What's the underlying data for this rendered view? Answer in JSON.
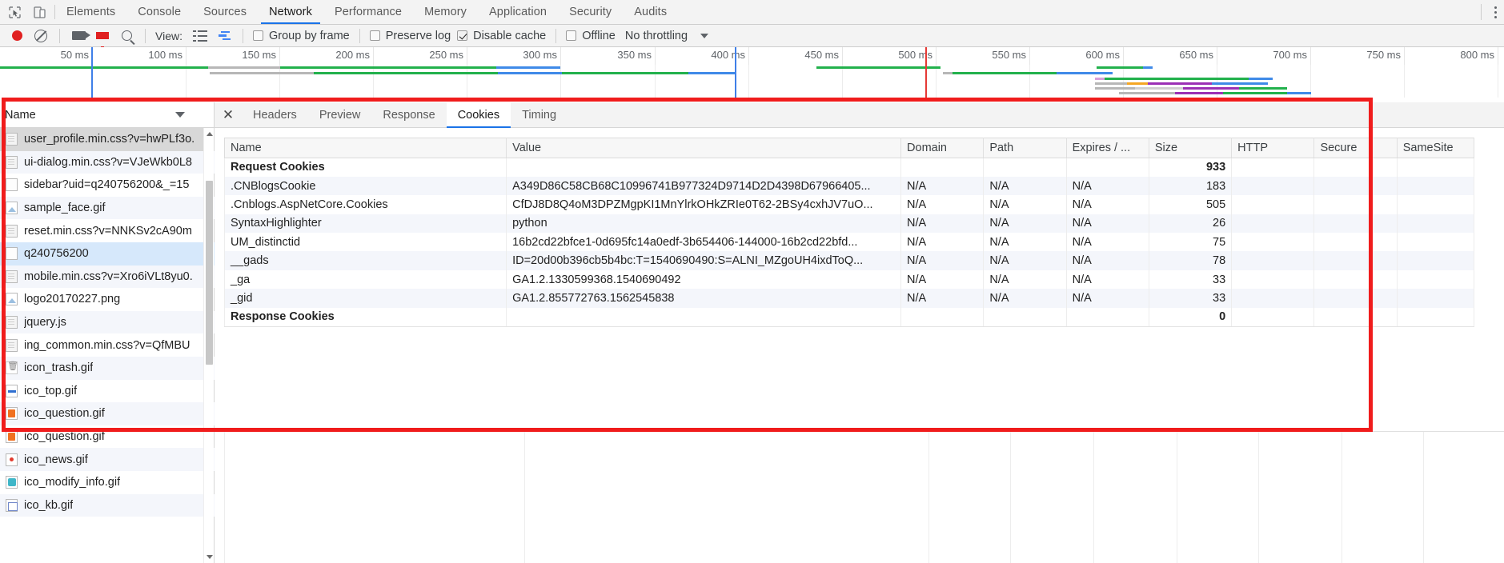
{
  "browser_tabs": {
    "inspect_icon": "inspect-element-icon",
    "device_icon": "device-toolbar-icon",
    "items": [
      {
        "label": "Elements",
        "active": false
      },
      {
        "label": "Console",
        "active": false
      },
      {
        "label": "Sources",
        "active": false
      },
      {
        "label": "Network",
        "active": true
      },
      {
        "label": "Performance",
        "active": false
      },
      {
        "label": "Memory",
        "active": false
      },
      {
        "label": "Application",
        "active": false
      },
      {
        "label": "Security",
        "active": false
      },
      {
        "label": "Audits",
        "active": false
      }
    ],
    "menu_icon": "kebab-menu-icon"
  },
  "network_toolbar": {
    "record_label": "record-button",
    "clear_label": "clear-button",
    "camera_label": "capture-screenshots-button",
    "filter_label": "filter-button",
    "search_label": "search-button",
    "view_label": "View:",
    "list_view": "list-view-icon",
    "waterfall_view": "waterfall-view-icon",
    "group_by_frame": {
      "label": "Group by frame",
      "checked": false,
      "disabled": true
    },
    "preserve_log": {
      "label": "Preserve log",
      "checked": false
    },
    "disable_cache": {
      "label": "Disable cache",
      "checked": true
    },
    "offline": {
      "label": "Offline",
      "checked": false
    },
    "throttling": {
      "label": "No throttling",
      "caret": "chevron-down-icon"
    }
  },
  "overview": {
    "ticks": [
      "50 ms",
      "100 ms",
      "150 ms",
      "200 ms",
      "250 ms",
      "300 ms",
      "350 ms",
      "400 ms",
      "450 ms",
      "500 ms",
      "550 ms",
      "600 ms",
      "650 ms",
      "700 ms",
      "750 ms",
      "800 ms"
    ],
    "dom_content_loaded_color": "#3f7fe8",
    "load_color": "#e53935"
  },
  "left_panel": {
    "column_header": "Name",
    "sort_caret": "chevron-down-icon",
    "files": [
      {
        "name": "user_profile.min.css?v=hwPLf3o.",
        "icon": "stylesheet-icon",
        "state": "hover"
      },
      {
        "name": "ui-dialog.min.css?v=VJeWkb0L8",
        "icon": "stylesheet-icon",
        "state": "odd"
      },
      {
        "name": "sidebar?uid=q240756200&_=15",
        "icon": "document-icon",
        "state": "normal"
      },
      {
        "name": "sample_face.gif",
        "icon": "image-icon",
        "state": "odd"
      },
      {
        "name": "reset.min.css?v=NNKSv2cA90m",
        "icon": "stylesheet-icon",
        "state": "normal"
      },
      {
        "name": "q240756200",
        "icon": "document-icon",
        "state": "selected"
      },
      {
        "name": "mobile.min.css?v=Xro6iVLt8yu0.",
        "icon": "stylesheet-icon",
        "state": "odd"
      },
      {
        "name": "logo20170227.png",
        "icon": "image-icon",
        "state": "normal"
      },
      {
        "name": "jquery.js",
        "icon": "script-icon",
        "state": "odd"
      },
      {
        "name": "ing_common.min.css?v=QfMBU",
        "icon": "stylesheet-icon",
        "state": "normal"
      },
      {
        "name": "icon_trash.gif",
        "icon": "trash-image-icon",
        "state": "odd"
      },
      {
        "name": "ico_top.gif",
        "icon": "blue-image-icon",
        "state": "normal"
      },
      {
        "name": "ico_question.gif",
        "icon": "orange-image-icon",
        "state": "odd"
      },
      {
        "name": "ico_question.gif",
        "icon": "orange-image-icon",
        "state": "normal"
      },
      {
        "name": "ico_news.gif",
        "icon": "red-image-icon",
        "state": "odd"
      },
      {
        "name": "ico_modify_info.gif",
        "icon": "teal-image-icon",
        "state": "normal"
      },
      {
        "name": "ico_kb.gif",
        "icon": "book-image-icon",
        "state": "odd"
      }
    ],
    "scrollbar": {
      "up_arrow": "scroll-up-arrow-icon",
      "down_arrow": "scroll-down-arrow-icon"
    }
  },
  "detail_panel": {
    "close_icon": "close-icon",
    "tabs": [
      {
        "label": "Headers",
        "active": false
      },
      {
        "label": "Preview",
        "active": false
      },
      {
        "label": "Response",
        "active": false
      },
      {
        "label": "Cookies",
        "active": true
      },
      {
        "label": "Timing",
        "active": false
      }
    ],
    "cookies_table": {
      "columns": [
        "Name",
        "Value",
        "Domain",
        "Path",
        "Expires / ...",
        "Size",
        "HTTP",
        "Secure",
        "SameSite"
      ],
      "rows": [
        {
          "type": "group",
          "name": "Request Cookies",
          "value": "",
          "domain": "",
          "path": "",
          "expires": "",
          "size": "933",
          "http": "",
          "secure": "",
          "samesite": ""
        },
        {
          "type": "data",
          "name": ".CNBlogsCookie",
          "value": "A349D86C58CB68C10996741B977324D9714D2D4398D67966405...",
          "domain": "N/A",
          "path": "N/A",
          "expires": "N/A",
          "size": "183",
          "http": "",
          "secure": "",
          "samesite": ""
        },
        {
          "type": "data",
          "name": ".Cnblogs.AspNetCore.Cookies",
          "value": "CfDJ8D8Q4oM3DPZMgpKI1MnYlrkOHkZRIe0T62-2BSy4cxhJV7uO...",
          "domain": "N/A",
          "path": "N/A",
          "expires": "N/A",
          "size": "505",
          "http": "",
          "secure": "",
          "samesite": ""
        },
        {
          "type": "data",
          "name": "SyntaxHighlighter",
          "value": "python",
          "domain": "N/A",
          "path": "N/A",
          "expires": "N/A",
          "size": "26",
          "http": "",
          "secure": "",
          "samesite": ""
        },
        {
          "type": "data",
          "name": "UM_distinctid",
          "value": "16b2cd22bfce1-0d695fc14a0edf-3b654406-144000-16b2cd22bfd...",
          "domain": "N/A",
          "path": "N/A",
          "expires": "N/A",
          "size": "75",
          "http": "",
          "secure": "",
          "samesite": ""
        },
        {
          "type": "data",
          "name": "__gads",
          "value": "ID=20d00b396cb5b4bc:T=1540690490:S=ALNI_MZgoUH4ixdToQ...",
          "domain": "N/A",
          "path": "N/A",
          "expires": "N/A",
          "size": "78",
          "http": "",
          "secure": "",
          "samesite": ""
        },
        {
          "type": "data",
          "name": "_ga",
          "value": "GA1.2.1330599368.1540690492",
          "domain": "N/A",
          "path": "N/A",
          "expires": "N/A",
          "size": "33",
          "http": "",
          "secure": "",
          "samesite": ""
        },
        {
          "type": "data",
          "name": "_gid",
          "value": "GA1.2.855772763.1562545838",
          "domain": "N/A",
          "path": "N/A",
          "expires": "N/A",
          "size": "33",
          "http": "",
          "secure": "",
          "samesite": ""
        },
        {
          "type": "group",
          "name": "Response Cookies",
          "value": "",
          "domain": "",
          "path": "",
          "expires": "",
          "size": "0",
          "http": "",
          "secure": "",
          "samesite": ""
        }
      ]
    }
  },
  "annotation": {
    "highlight_color": "#f01c1c"
  }
}
